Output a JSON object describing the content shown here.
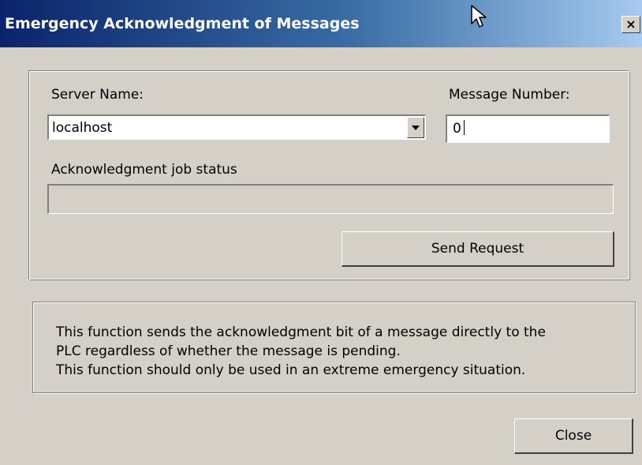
{
  "window": {
    "title": "Emergency Acknowledgment of Messages",
    "close_glyph": "×"
  },
  "form": {
    "server_label": "Server Name:",
    "server_value": "localhost",
    "message_label": "Message Number:",
    "message_value": "0",
    "status_label": "Acknowledgment job status",
    "status_value": "",
    "send_button": "Send Request"
  },
  "info": {
    "lines": [
      "This function sends the acknowledgment bit of a message directly to the",
      "PLC regardless of whether the message is pending.",
      "This function should only be used in an extreme emergency situation."
    ]
  },
  "footer": {
    "close_button": "Close"
  },
  "icons": {
    "dropdown": "chevron-down-icon",
    "cursor": "mouse-pointer-icon"
  },
  "colors": {
    "titlebar_start": "#0a246a",
    "titlebar_end": "#a6caf0",
    "dialog_bg": "#d4d0c8"
  }
}
